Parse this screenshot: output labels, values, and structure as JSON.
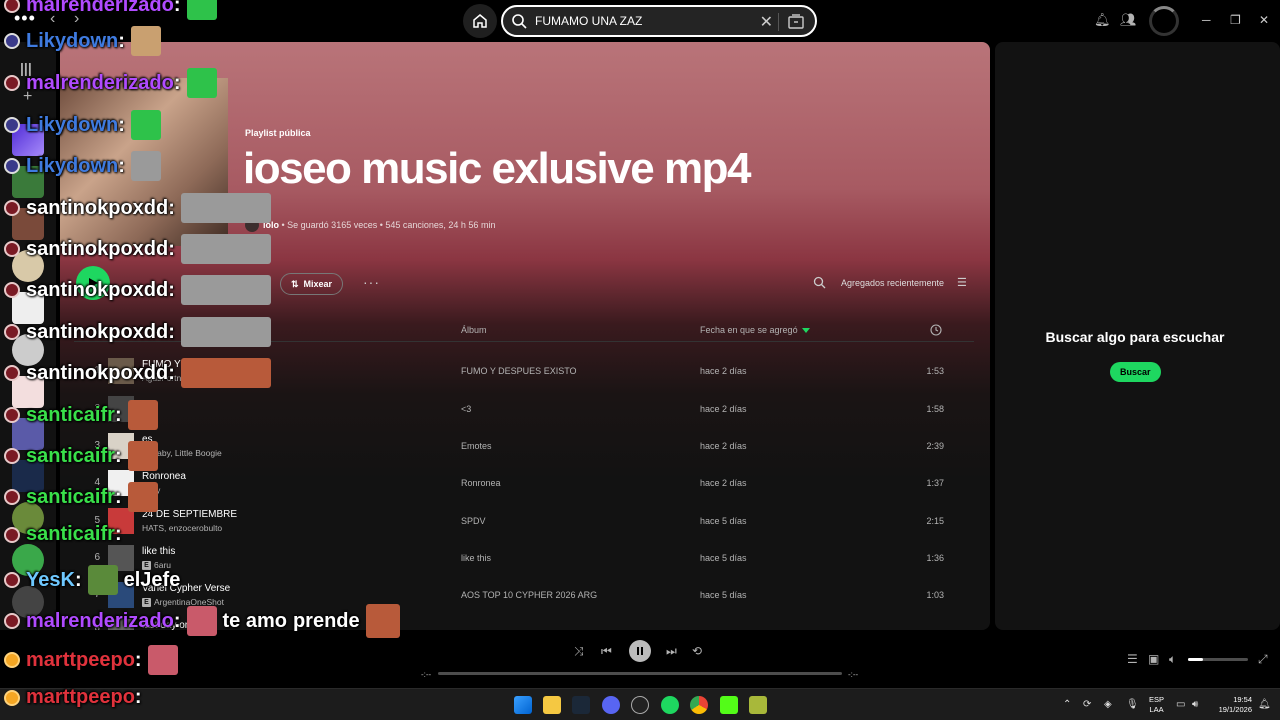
{
  "topbar": {
    "dots": "•••",
    "search_value": "FUMAMO UNA ZAZ",
    "clear": "✕"
  },
  "playlist": {
    "type": "Playlist pública",
    "title": "ioseo music exlusive mp4",
    "owner": "lolo",
    "meta": " • Se guardó 3165 veces • 545 canciones, 24 h 56 min"
  },
  "actions": {
    "mix_label": "Mixear",
    "more": "···",
    "sort_label": "Agregados recientemente"
  },
  "table": {
    "col_album": "Álbum",
    "col_date": "Fecha en que se agregó",
    "rows": [
      {
        "num": "1",
        "title": "FUMO Y D",
        "artist": "AgusFortnite",
        "explicit": false,
        "album": "FUMO Y DESPUES EXISTO",
        "date": "hace 2 días",
        "duration": "1:53",
        "thumb": "#6a5a4a"
      },
      {
        "num": "2",
        "title": "",
        "artist": "ll",
        "explicit": false,
        "album": "<3",
        "date": "hace 2 días",
        "duration": "1:58",
        "thumb": "#444"
      },
      {
        "num": "3",
        "title": "es",
        "artist": "rrobaby, Little Boogie",
        "explicit": false,
        "album": "Emotes",
        "date": "hace 2 días",
        "duration": "2:39",
        "thumb": "#d9d2c7"
      },
      {
        "num": "4",
        "title": "Ronronea",
        "artist": "baby",
        "explicit": false,
        "album": "Ronronea",
        "date": "hace 2 días",
        "duration": "1:37",
        "thumb": "#f0f0f0"
      },
      {
        "num": "5",
        "title": "24 DE SEPTIEMBRE",
        "artist": "HATS, enzocerobulto",
        "explicit": false,
        "album": "SPDV",
        "date": "hace 5 días",
        "duration": "2:15",
        "thumb": "#c83a3a"
      },
      {
        "num": "6",
        "title": "like this",
        "artist": "6aru",
        "explicit": true,
        "album": "like this",
        "date": "hace 5 días",
        "duration": "1:36",
        "thumb": "#555"
      },
      {
        "num": "7",
        "title": "Vahel Cypher Verse",
        "artist": "ArgentinaOneShot",
        "explicit": true,
        "album": "AOS TOP 10 CYPHER 2026 ARG",
        "date": "hace 5 días",
        "duration": "1:03",
        "thumb": "#2a4a7a"
      },
      {
        "num": "8",
        "title": "last day on earth",
        "artist": "",
        "explicit": false,
        "album": "",
        "date": "",
        "duration": "",
        "thumb": "#666"
      }
    ]
  },
  "right_panel": {
    "title": "Buscar algo para escuchar",
    "button": "Buscar"
  },
  "player": {
    "time_left": "-:--",
    "time_right": "-:--",
    "progress": 0,
    "volume": 0.25
  },
  "taskbar": {
    "lang_line1": "ESP",
    "lang_line2": "LAA",
    "time": "19:54",
    "date": "19/1/2026"
  },
  "chat": [
    {
      "user": "malrenderizado",
      "color": "#b04bff",
      "msg": "",
      "partial": true
    },
    {
      "user": "Likydown",
      "color": "#3f7be0",
      "msg": ""
    },
    {
      "user": "malrenderizado",
      "color": "#b04bff",
      "msg": ""
    },
    {
      "user": "Likydown",
      "color": "#3f7be0",
      "msg": ""
    },
    {
      "user": "Likydown",
      "color": "#3f7be0",
      "msg": ""
    },
    {
      "user": "santinokpoxdd",
      "color": "#ffffff",
      "msg": ""
    },
    {
      "user": "santinokpoxdd",
      "color": "#ffffff",
      "msg": ""
    },
    {
      "user": "santinokpoxdd",
      "color": "#ffffff",
      "msg": ""
    },
    {
      "user": "santinokpoxdd",
      "color": "#ffffff",
      "msg": ""
    },
    {
      "user": "santinokpoxdd",
      "color": "#ffffff",
      "msg": ""
    },
    {
      "user": "santicaifr",
      "color": "#39e04a",
      "msg": ""
    },
    {
      "user": "santicaifr",
      "color": "#39e04a",
      "msg": ""
    },
    {
      "user": "santicaifr",
      "color": "#39e04a",
      "msg": ""
    },
    {
      "user": "santicaifr",
      "color": "#39e04a",
      "msg": ""
    },
    {
      "user": "YesK",
      "color": "#6ec8ff",
      "msg": "elJefe"
    },
    {
      "user": "malrenderizado",
      "color": "#b04bff",
      "msg": "te amo",
      "msg2": "prende"
    },
    {
      "user": "marttpeepo",
      "color": "#e0323c",
      "msg": ""
    },
    {
      "user": "marttpeepo",
      "color": "#e0323c",
      "msg": ""
    }
  ],
  "colors": {
    "accent": "#1ed760",
    "bg": "#121212"
  }
}
